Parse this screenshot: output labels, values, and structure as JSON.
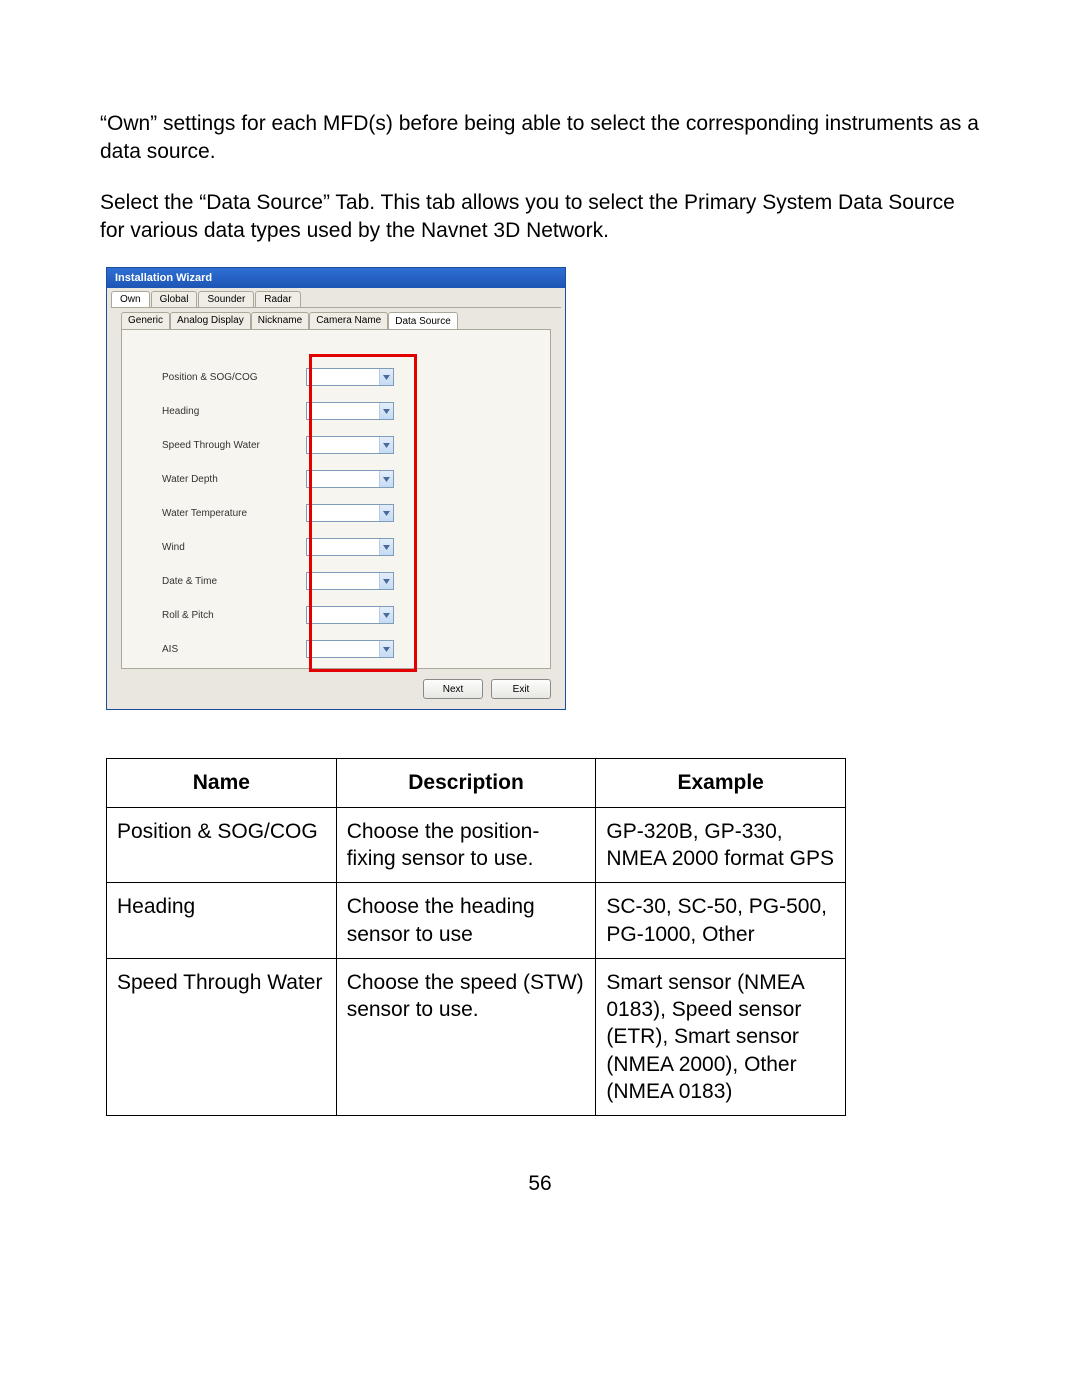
{
  "paragraphs": {
    "p1": "“Own” settings for each MFD(s) before being able to select the corresponding instruments as a data source.",
    "p2": "Select the “Data Source” Tab.  This tab allows you to select the Primary System Data Source for various data types used by the Navnet 3D Network."
  },
  "wizard": {
    "title": "Installation Wizard",
    "tabs_primary": [
      "Own",
      "Global",
      "Sounder",
      "Radar"
    ],
    "tabs_primary_active_index": 0,
    "tabs_secondary": [
      "Generic",
      "Analog Display",
      "Nickname",
      "Camera Name",
      "Data Source"
    ],
    "tabs_secondary_active_index": 4,
    "rows": [
      {
        "label": "Position & SOG/COG",
        "value": ""
      },
      {
        "label": "Heading",
        "value": ""
      },
      {
        "label": "Speed Through Water",
        "value": ""
      },
      {
        "label": "Water Depth",
        "value": ""
      },
      {
        "label": "Water Temperature",
        "value": ""
      },
      {
        "label": "Wind",
        "value": ""
      },
      {
        "label": "Date & Time",
        "value": ""
      },
      {
        "label": "Roll & Pitch",
        "value": ""
      },
      {
        "label": "AIS",
        "value": ""
      }
    ],
    "buttons": {
      "next": "Next",
      "exit": "Exit"
    }
  },
  "table": {
    "headers": {
      "name": "Name",
      "description": "Description",
      "example": "Example"
    },
    "rows": [
      {
        "name": "Position & SOG/COG",
        "description": "Choose the position-fixing sensor to use.",
        "example": "GP-320B, GP-330, NMEA 2000 format GPS"
      },
      {
        "name": "Heading",
        "description": "Choose the heading sensor to use",
        "example": "SC-30, SC-50, PG-500, PG-1000, Other"
      },
      {
        "name": "Speed Through Water",
        "description": "Choose the speed (STW) sensor to use.",
        "example": "Smart sensor (NMEA 0183), Speed sensor (ETR), Smart sensor (NMEA 2000), Other (NMEA 0183)"
      }
    ]
  },
  "page_number": "56"
}
